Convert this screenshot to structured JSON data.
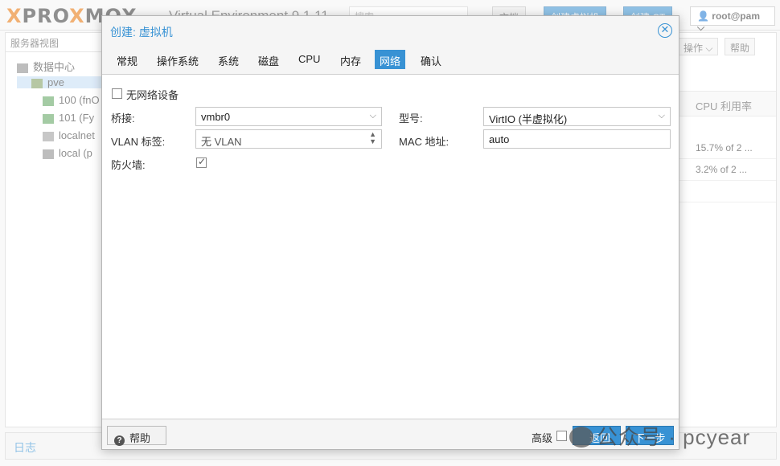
{
  "topbar": {
    "logo_part1": "PRO",
    "logo_x": "X",
    "logo_part2": "MOX",
    "version": "Virtual Environment 9.1.11",
    "search_placeholder": "搜索",
    "docs_label": "文档",
    "create_vm_label": "创建虚拟机",
    "create_ct_label": "创建 CT",
    "user_label": "root@pam"
  },
  "sidebar": {
    "view_label": "服务器视图",
    "items": [
      {
        "label": "数据中心"
      },
      {
        "label": "pve"
      },
      {
        "label": "100 (fnO"
      },
      {
        "label": "101 (Fy"
      },
      {
        "label": "localnet"
      },
      {
        "label": "local (p"
      }
    ]
  },
  "right_panel": {
    "ops_label": "操作",
    "help_label": "帮助",
    "column": "CPU 利用率",
    "rows": [
      "15.7% of 2 ...",
      "3.2% of 2 ..."
    ]
  },
  "logbar": {
    "label": "日志"
  },
  "dialog": {
    "title": "创建: 虚拟机",
    "tabs": [
      "常规",
      "操作系统",
      "系统",
      "磁盘",
      "CPU",
      "内存",
      "网络",
      "确认"
    ],
    "active_tab": "网络",
    "no_network_label": "无网络设备",
    "bridge_label": "桥接:",
    "bridge_value": "vmbr0",
    "vlan_label": "VLAN 标签:",
    "vlan_value": "无 VLAN",
    "firewall_label": "防火墙:",
    "model_label": "型号:",
    "model_value": "VirtIO (半虚拟化)",
    "mac_label": "MAC 地址:",
    "mac_value": "auto",
    "footer": {
      "help_label": "帮助",
      "advanced_label": "高级",
      "back_label": "返回",
      "next_label": "下一步"
    }
  },
  "watermark": {
    "text": "公众号 · pcyear"
  },
  "colors": {
    "accent": "#3892d4",
    "logo_x": "#e57000"
  }
}
